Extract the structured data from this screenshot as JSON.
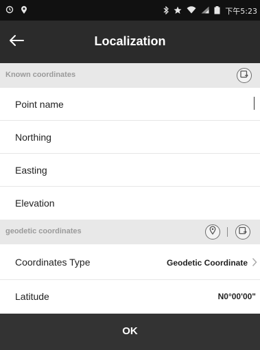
{
  "status_bar": {
    "time": "下午5:23",
    "icons": [
      "alarm-icon",
      "location-icon",
      "bluetooth-icon",
      "star-icon",
      "wifi-icon",
      "signal-icon",
      "battery-icon"
    ]
  },
  "app_bar": {
    "title": "Localization",
    "back_icon": "back-arrow-icon"
  },
  "known_section": {
    "label": "Known coordinates",
    "action_icon": "import-file-icon"
  },
  "known_fields": [
    {
      "label": "Point name",
      "value": ""
    },
    {
      "label": "Northing",
      "value": ""
    },
    {
      "label": "Easting",
      "value": ""
    },
    {
      "label": "Elevation",
      "value": ""
    }
  ],
  "geodetic_section": {
    "label": "geodetic coordinates",
    "icons": [
      "pin-icon",
      "import-file-icon"
    ]
  },
  "geodetic_fields": {
    "type": {
      "label": "Coordinates Type",
      "value": "Geodetic Coordinate"
    },
    "latitude": {
      "label": "Latitude",
      "value": "N0°00'00\""
    }
  },
  "footer": {
    "ok_label": "OK"
  },
  "colors": {
    "status_bar": "#111111",
    "app_bar": "#2b2b2b",
    "section_bg": "#e8e8e8",
    "ok_bar": "#333333"
  }
}
